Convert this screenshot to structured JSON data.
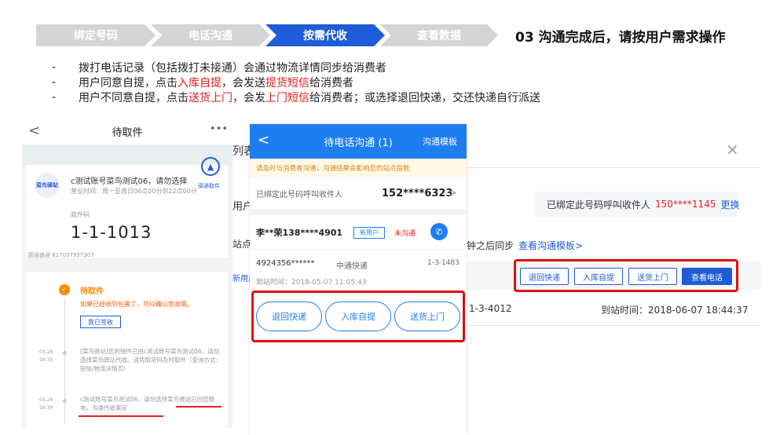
{
  "steps": [
    "绑定号码",
    "电话沟通",
    "按需代收",
    "查看数据"
  ],
  "step_title": "03 沟通完成后，请按用户需求操作",
  "bullets": [
    {
      "dash": "-",
      "parts": [
        {
          "t": "拨打电话记录（包括拨打未接通）会通过物流详情同步给消费者",
          "red": false
        }
      ]
    },
    {
      "dash": "-",
      "parts": [
        {
          "t": "用户同意自提，点击",
          "red": false
        },
        {
          "t": "入库自提",
          "red": true
        },
        {
          "t": "，会发送",
          "red": false
        },
        {
          "t": "提货短信",
          "red": true
        },
        {
          "t": "给消费者",
          "red": false
        }
      ]
    },
    {
      "dash": "-",
      "parts": [
        {
          "t": "用户不同意自提，点击",
          "red": false
        },
        {
          "t": "送货上门",
          "red": true
        },
        {
          "t": "，会发",
          "red": false
        },
        {
          "t": "上门短信",
          "red": true
        },
        {
          "t": "给消费者；或选择退回快递，交还快递自行派送",
          "red": false
        }
      ]
    }
  ],
  "left_phone": {
    "back": "<",
    "title": "待取件",
    "more": "•••",
    "logo": "菜鸟驿站",
    "store_name": "c测试账号菜鸟测试06，请勿选择",
    "hours": "营业时间：周一至周日06点00分到22点00分",
    "code_label": "取件码",
    "code": "1-1-1013",
    "pickup_label": "驿递取件",
    "tracking": "圆通速递 817037957307",
    "pending_title": "待取件",
    "pending_desc": "如果已经收到包裹了，可以确认签收哦。",
    "sign_button": "我已签收",
    "timeline": [
      {
        "date": "03-26",
        "time": "16:35",
        "text": "[菜鸟驿站]您的快件已由c测试账号菜鸟测试06，请勿选择菜鸟驿站代收。请凭取货码及时取件（查询方式：短信/物流详情页）"
      },
      {
        "date": "03-26",
        "time": "16:34",
        "text": "c测试账号菜鸟测试06，请勿选择菜鸟驿站已回您致电，沟通代收事宜"
      }
    ]
  },
  "admin": {
    "title_fragment": "列表",
    "close": "×",
    "side1": "用户",
    "side2": "站点",
    "side3": "新用户",
    "bound_label": "已绑定此号码呼叫收件人",
    "bound_number": "150****1145",
    "bound_change": "更换",
    "sync_text": "钟之后同步",
    "sync_link": "查看沟通模板>",
    "buttons": [
      "退回快递",
      "入库自提",
      "送货上门",
      "查看电话"
    ],
    "row_code": "1-3-4012",
    "row_time": "到站时间：2018-06-07 18:44:37"
  },
  "mid_phone": {
    "back": "<",
    "title": "待电话沟通 (1)",
    "template": "沟通模板",
    "notice": "请及时与消费者沟通，沟通结果会影响您的站点指数",
    "bound_label": "已绑定此号码呼叫收件人",
    "bound_number": "152****6323",
    "arrow": ">",
    "customer": "李**荣138****4901",
    "tag_new": "新用户",
    "tag_status": "未沟通",
    "waybill": "4924356******",
    "carrier": "中通快递",
    "shelf": "1-3-1483",
    "arrived": "到站时间：2018-05-07 11:05:43",
    "buttons": [
      "退回快递",
      "入库自提",
      "送货上门"
    ]
  },
  "colors": {
    "accent": "#1f5cd9",
    "highlight_red": "#e01010",
    "pending_orange": "#ff8a00"
  },
  "icons": {
    "call": "phone-icon",
    "pickup": "box-icon",
    "back": "chevron-left-icon",
    "close": "close-icon"
  }
}
